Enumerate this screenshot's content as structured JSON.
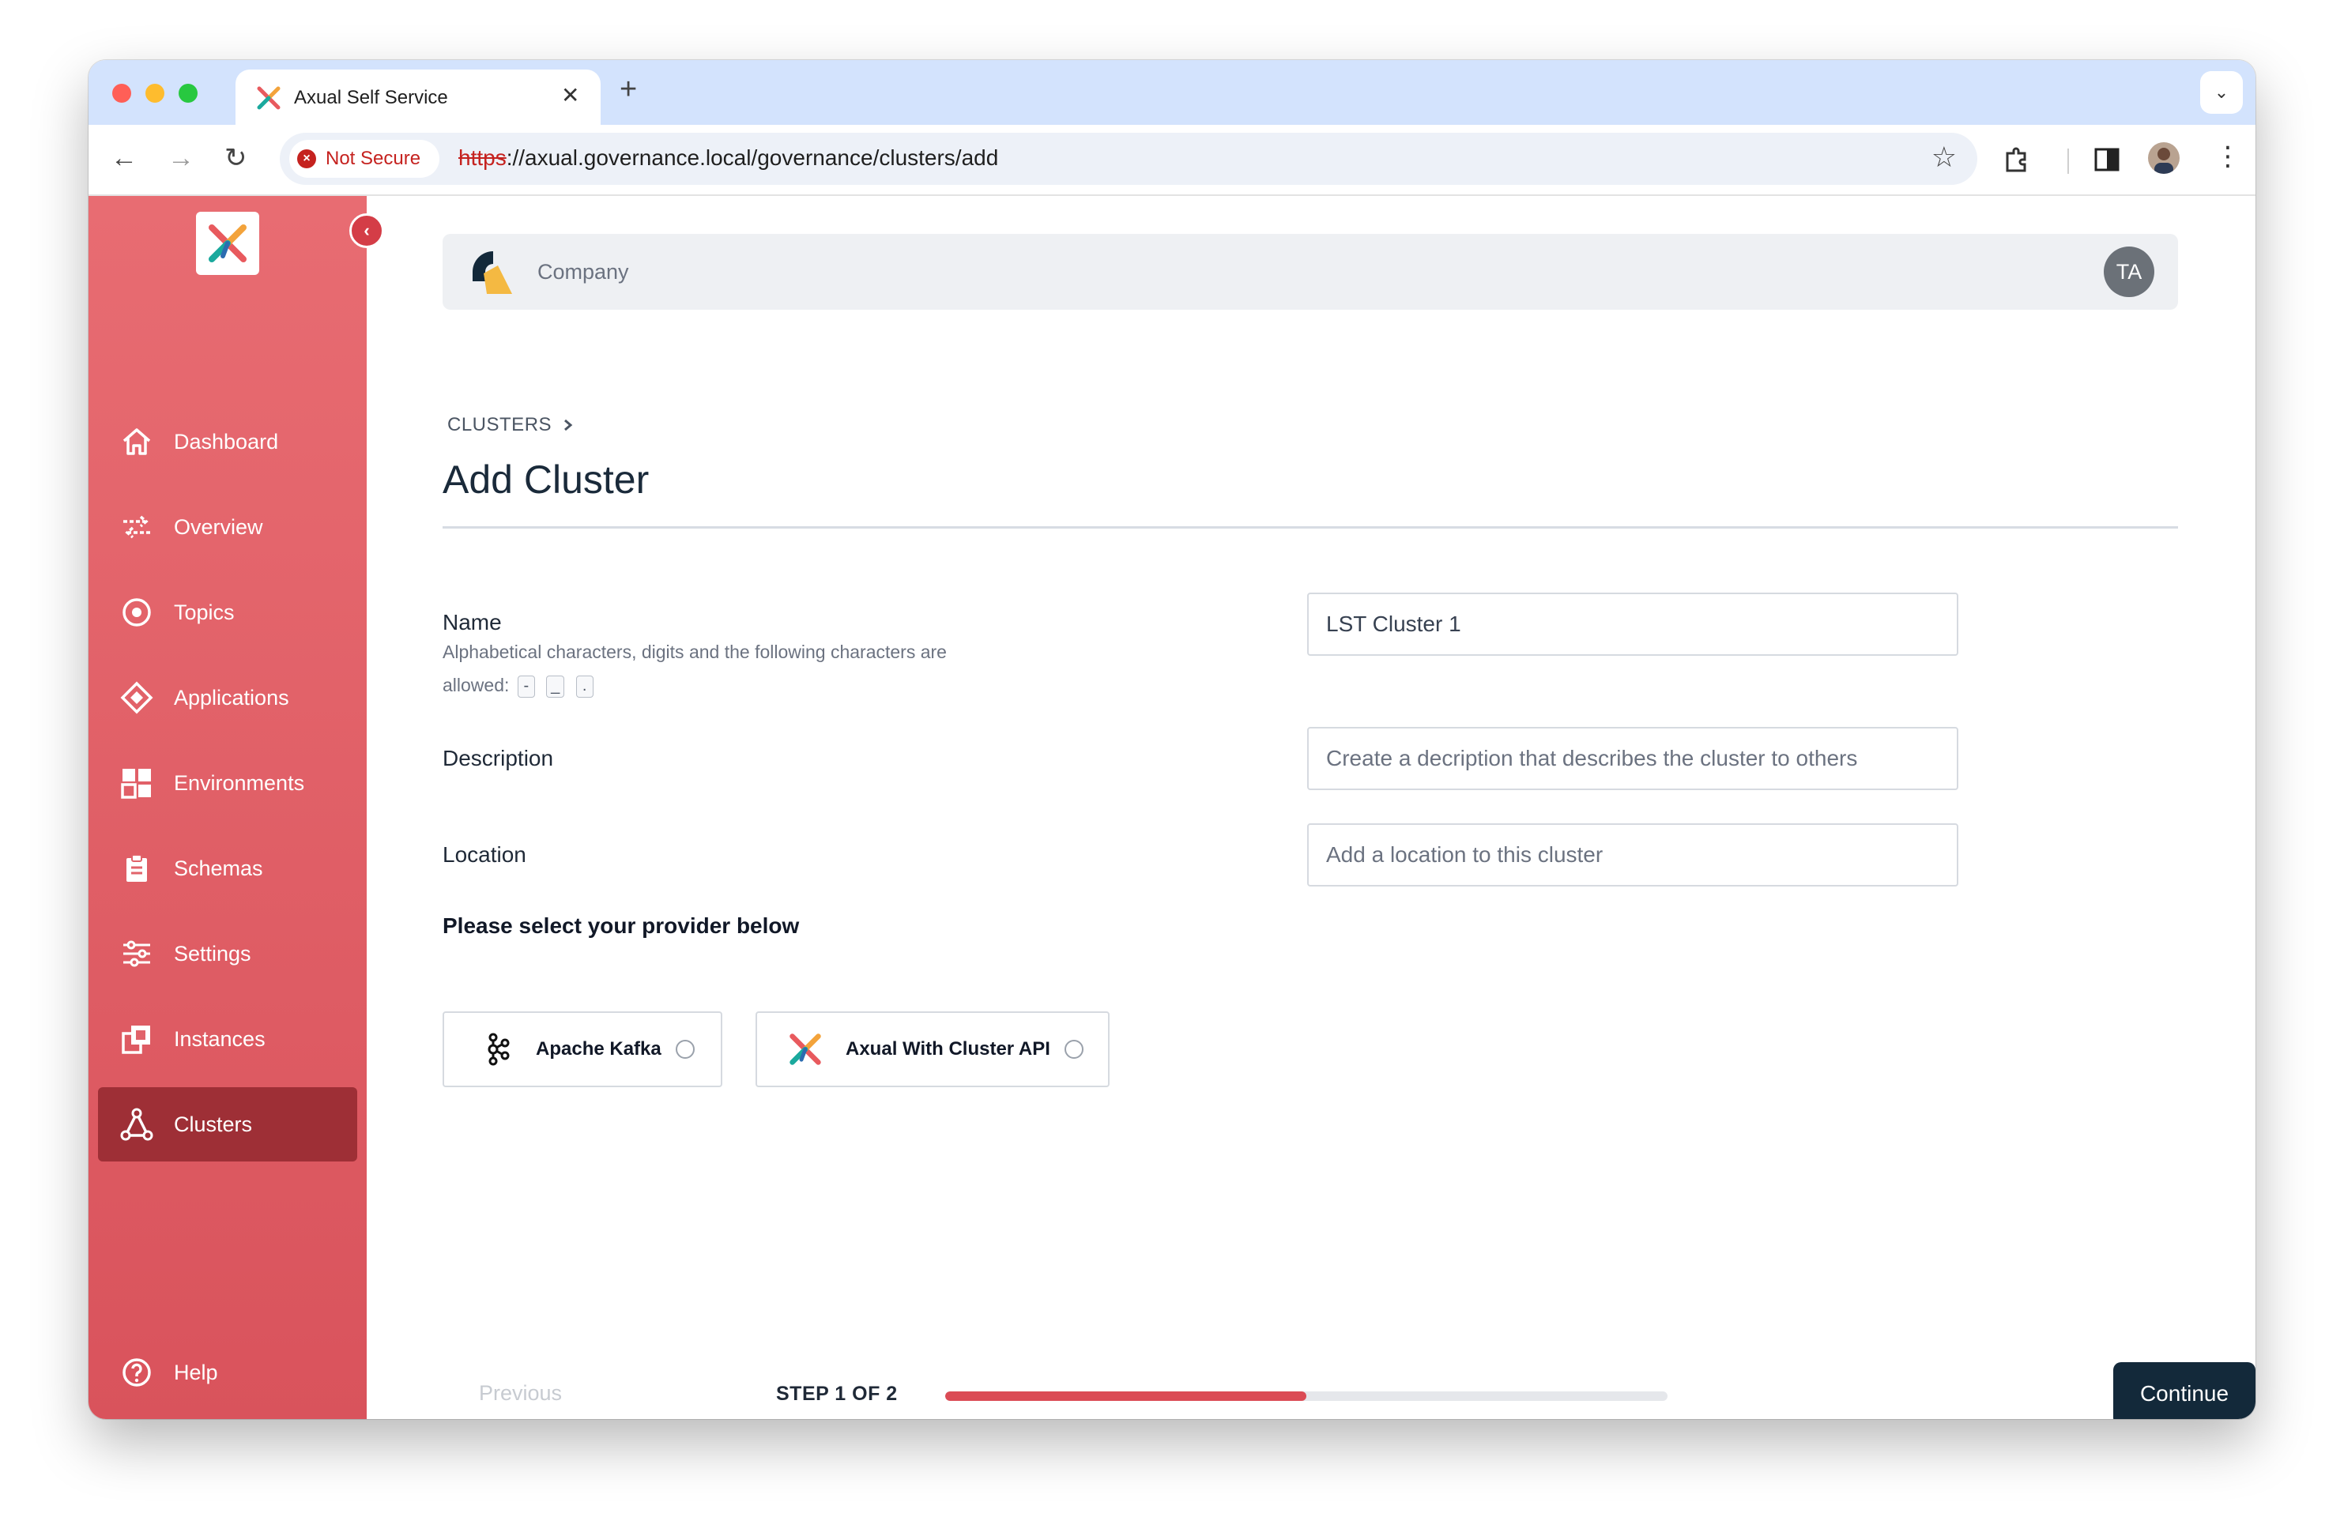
{
  "browser": {
    "tab_title": "Axual Self Service",
    "security_label": "Not Secure",
    "url_scheme": "https",
    "url_rest": "://axual.governance.local/governance/clusters/add"
  },
  "sidebar": {
    "items": [
      {
        "label": "Dashboard",
        "icon": "home-icon"
      },
      {
        "label": "Overview",
        "icon": "arrows-exchange-icon"
      },
      {
        "label": "Topics",
        "icon": "target-icon"
      },
      {
        "label": "Applications",
        "icon": "diamond-icon"
      },
      {
        "label": "Environments",
        "icon": "grid-icon"
      },
      {
        "label": "Schemas",
        "icon": "clipboard-icon"
      },
      {
        "label": "Settings",
        "icon": "sliders-icon"
      },
      {
        "label": "Instances",
        "icon": "instances-icon"
      },
      {
        "label": "Clusters",
        "icon": "cluster-icon",
        "active": true
      }
    ],
    "help_label": "Help"
  },
  "header": {
    "company_name": "Company",
    "avatar_initials": "TA"
  },
  "breadcrumb": {
    "label": "CLUSTERS"
  },
  "page": {
    "title": "Add Cluster"
  },
  "form": {
    "name": {
      "label": "Name",
      "help": "Alphabetical characters, digits and the following characters are allowed:",
      "allowed_chars": [
        "-",
        "_",
        "."
      ],
      "value": "LST Cluster 1"
    },
    "description": {
      "label": "Description",
      "placeholder": "Create a decription that describes the cluster to others"
    },
    "location": {
      "label": "Location",
      "placeholder": "Add a location to this cluster"
    },
    "provider_title": "Please select your provider below",
    "providers": [
      {
        "label": "Apache Kafka",
        "icon": "kafka-icon"
      },
      {
        "label": "Axual With Cluster API",
        "icon": "axual-logo-icon"
      }
    ]
  },
  "wizard": {
    "previous_label": "Previous",
    "step_label": "STEP 1 OF 2",
    "progress": 0.5,
    "continue_label": "Continue"
  },
  "colors": {
    "sidebar": "#e86c72",
    "sidebar_active": "#9e2f36",
    "primary_button": "#13293a",
    "progress": "#db4b55"
  }
}
